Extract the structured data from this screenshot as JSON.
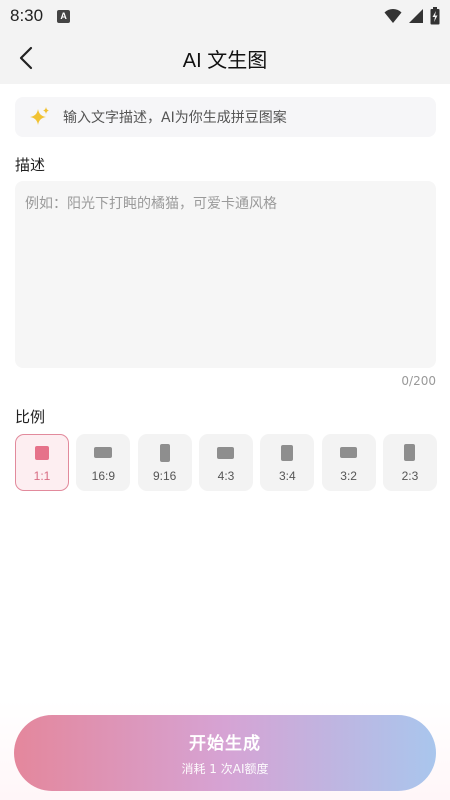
{
  "status_bar": {
    "time": "8:30",
    "notification_letter": "A"
  },
  "header": {
    "title": "AI 文生图"
  },
  "tip": {
    "text": "输入文字描述，AI为你生成拼豆图案",
    "icon": "sparkle-icon"
  },
  "description": {
    "label": "描述",
    "placeholder": "例如：阳光下打盹的橘猫，可爱卡通风格",
    "value": "",
    "counter": "0/200"
  },
  "ratio": {
    "label": "比例",
    "selected": "1:1",
    "options": [
      {
        "label": "1:1",
        "orientation": "square"
      },
      {
        "label": "16:9",
        "orientation": "landscape"
      },
      {
        "label": "9:16",
        "orientation": "portrait"
      },
      {
        "label": "4:3",
        "orientation": "landscape"
      },
      {
        "label": "3:4",
        "orientation": "portrait"
      },
      {
        "label": "3:2",
        "orientation": "landscape"
      },
      {
        "label": "2:3",
        "orientation": "portrait"
      }
    ]
  },
  "start_button": {
    "title": "开始生成",
    "subtitle": "消耗 1 次AI额度"
  },
  "colors": {
    "accent_pink": "#e6728a",
    "gradient_start": "#e4879c",
    "gradient_end": "#a9c6ed"
  }
}
